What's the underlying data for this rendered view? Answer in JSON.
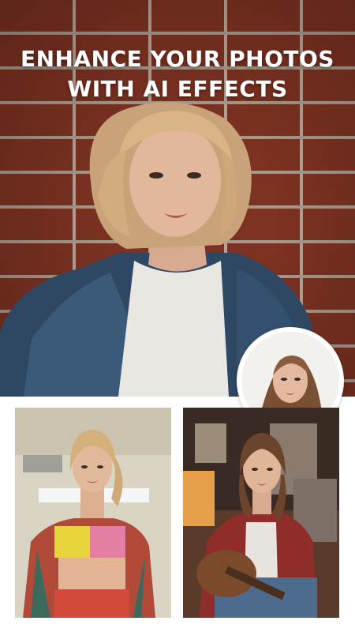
{
  "headline": {
    "line1": "ENHANCE YOUR PHOTOS",
    "line2": "WITH AI EFFECTS"
  },
  "colors": {
    "headline_text": "#ffffff",
    "background": "#ffffff",
    "brick": "#8a3725",
    "mortar": "#c9b6a4"
  }
}
